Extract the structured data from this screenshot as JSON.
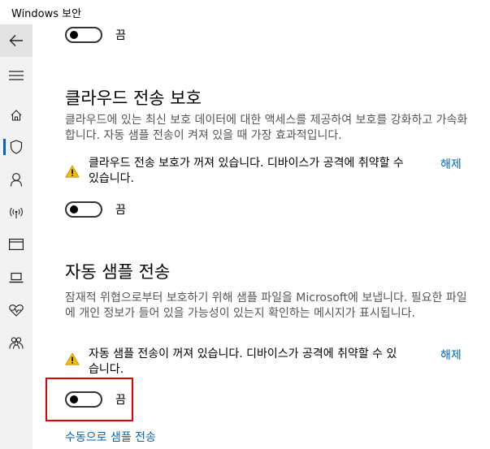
{
  "window": {
    "title": "Windows 보안"
  },
  "sidebar": {
    "items": [
      {
        "name": "back",
        "icon": "back-arrow-icon"
      },
      {
        "name": "menu",
        "icon": "hamburger-menu-icon"
      },
      {
        "name": "home",
        "icon": "home-icon"
      },
      {
        "name": "virus-protection",
        "icon": "shield-icon",
        "active": true
      },
      {
        "name": "account",
        "icon": "person-icon"
      },
      {
        "name": "firewall",
        "icon": "wireless-icon"
      },
      {
        "name": "app-browser",
        "icon": "browser-window-icon"
      },
      {
        "name": "device-security",
        "icon": "laptop-icon"
      },
      {
        "name": "device-health",
        "icon": "heart-pulse-icon"
      },
      {
        "name": "family",
        "icon": "family-icon"
      }
    ]
  },
  "top_toggle": {
    "state_label": "끔"
  },
  "cloud": {
    "title": "클라우드 전송 보호",
    "desc": "클라우드에 있는 최신 보호 데이터에 대한 액세스를 제공하여 보호를 강화하고 가속화합니다. 자동 샘플 전송이 켜져 있을 때 가장 효과적입니다.",
    "warning": "클라우드 전송 보호가 꺼져 있습니다. 디바이스가 공격에 취약할 수 있습니다.",
    "dismiss": "해제",
    "toggle_label": "끔"
  },
  "sample": {
    "title": "자동 샘플 전송",
    "desc": "잠재적 위협으로부터 보호하기 위해 샘플 파일을 Microsoft에 보냅니다. 필요한 파일에 개인 정보가 들어 있을 가능성이 있는지 확인하는 메시지가 표시됩니다.",
    "warning": "자동 샘플 전송이 꺼져 있습니다. 디바이스가 공격에 취약할 수 있습니다.",
    "dismiss": "해제",
    "toggle_label": "끔",
    "manual_link": "수동으로 샘플 전송"
  },
  "colors": {
    "accent": "#0067b8",
    "warning": "#f0c000",
    "highlight": "#e00000"
  }
}
